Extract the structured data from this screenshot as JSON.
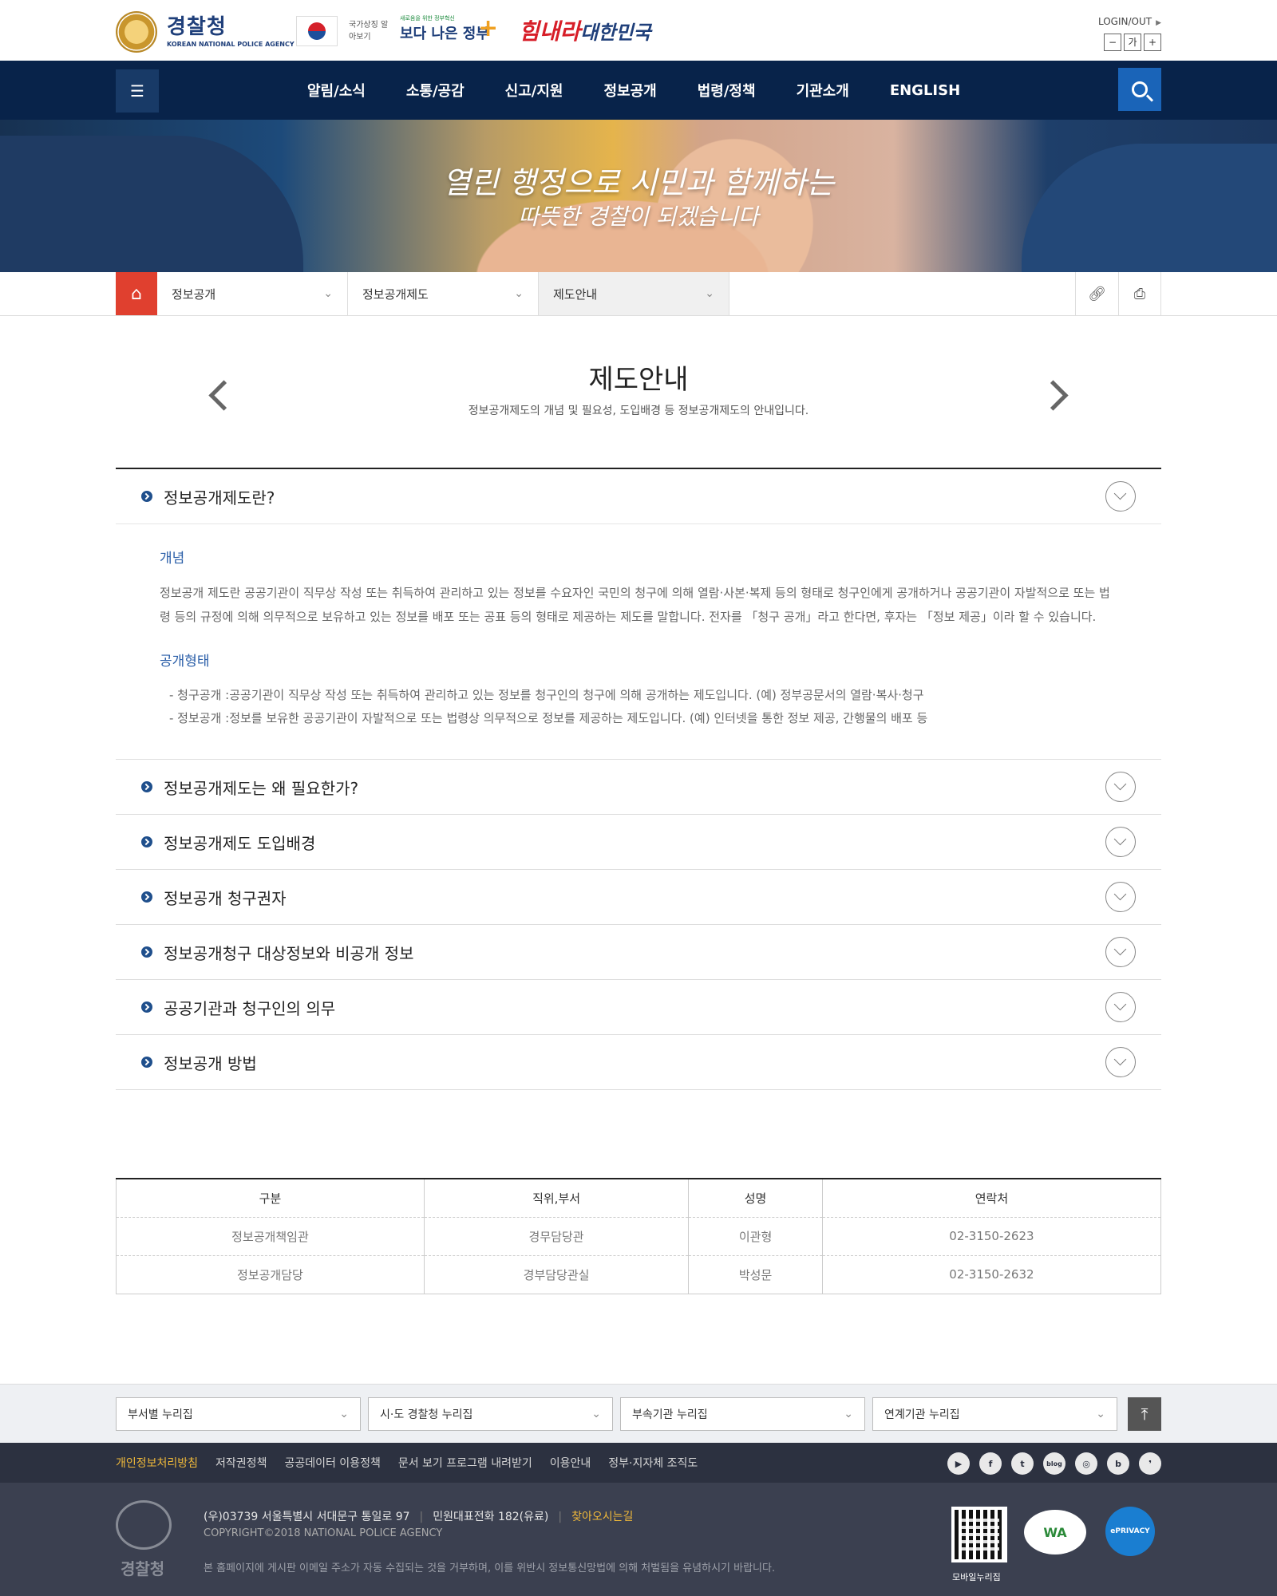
{
  "header": {
    "logo_title": "경찰청",
    "logo_sub": "KOREAN NATIONAL POLICE AGENCY",
    "flag_label": "국가상징 알아보기",
    "banner_gov_small": "새로움을 위한 정부혁신",
    "banner_gov_big": "보다 나은 정부",
    "banner_him_a": "힘내라",
    "banner_him_b": "대한민국",
    "login": "LOGIN/OUT",
    "font_minus": "−",
    "font_size": "가",
    "font_plus": "+"
  },
  "nav": {
    "items": [
      "알림/소식",
      "소통/공감",
      "신고/지원",
      "정보공개",
      "법령/정책",
      "기관소개",
      "ENGLISH"
    ]
  },
  "banner": {
    "line1": "열린 행정으로 시민과 함께하는",
    "line2": "따뜻한 경찰이 되겠습니다"
  },
  "breadcrumb": {
    "items": [
      "정보공개",
      "정보공개제도",
      "제도안내"
    ]
  },
  "page": {
    "title": "제도안내",
    "desc": "정보공개제도의 개념 및 필요성, 도입배경 등 정보공개제도의 안내입니다."
  },
  "accordion": {
    "open": {
      "title": "정보공개제도란?",
      "h1": "개념",
      "p1": "정보공개 제도란 공공기관이 직무상 작성 또는 취득하여 관리하고 있는 정보를 수요자인 국민의 청구에 의해 열람·사본·복제 등의 형태로 청구인에게 공개하거나 공공기관이 자발적으로 또는 법령 등의 규정에 의해 의무적으로 보유하고 있는 정보를 배포 또는 공표 등의 형태로 제공하는 제도를 말합니다. 전자를 「청구 공개」라고 한다면, 후자는 「정보 제공」이라 할 수 있습니다.",
      "h2": "공개형태",
      "li1": "- 청구공개 :공공기관이 직무상 작성 또는 취득하여 관리하고 있는 정보를 청구인의 청구에 의해 공개하는 제도입니다. (예) 정부공문서의 열람·복사·청구",
      "li2": "- 정보공개 :정보를 보유한 공공기관이 자발적으로 또는 법령상 의무적으로 정보를 제공하는 제도입니다. (예) 인터넷을 통한 정보 제공, 간행물의 배포 등"
    },
    "closed": [
      "정보공개제도는 왜 필요한가?",
      "정보공개제도 도입배경",
      "정보공개 청구권자",
      "정보공개청구 대상정보와 비공개 정보",
      "공공기관과 청구인의 의무",
      "정보공개 방법"
    ]
  },
  "contact_table": {
    "headers": [
      "구분",
      "직위,부서",
      "성명",
      "연락처"
    ],
    "rows": [
      [
        "정보공개책임관",
        "경무담당관",
        "이관형",
        "02-3150-2623"
      ],
      [
        "정보공개담당",
        "경부담당관실",
        "박성문",
        "02-3150-2632"
      ]
    ]
  },
  "footer": {
    "selects": [
      "부서별 누리집",
      "시·도 경찰청 누리집",
      "부속기관 누리집",
      "연계기관 누리집"
    ],
    "top_icon": "arrow-up-icon",
    "links": [
      "개인정보처리방침",
      "저작권정책",
      "공공데이터 이용정책",
      "문서 보기 프로그램 내려받기",
      "이용안내",
      "정부·지자체 조직도"
    ],
    "sns": [
      "youtube-icon",
      "facebook-icon",
      "twitter-icon",
      "blog-icon",
      "instagram-icon",
      "band-icon",
      "kakao-icon"
    ],
    "sns_labels": [
      "▶",
      "f",
      "t",
      "blog",
      "◎",
      "b",
      "❜"
    ],
    "emblem_text": "경찰청",
    "address": "(우)03739 서울특별시 서대문구 통일로 97",
    "phone": "민원대표전화 182(유료)",
    "directions": "찾아오시는길",
    "copyright": "COPYRIGHT©2018 NATIONAL POLICE AGENCY",
    "notice": "본 홈페이지에 게시판 이메일 주소가 자동 수집되는 것을 거부하며, 이를 위반시 정보통신망법에 의해 처벌됨을 유념하시기 바랍니다.",
    "qr_label": "모바일누리집",
    "wa_label": "WA",
    "ep_label": "ePRIVACY"
  },
  "colors": {
    "nav_bg": "#08234a",
    "home_red": "#e0402f",
    "accent_blue": "#2a5ea8",
    "footer_bg": "#3b4050",
    "footer_highlight": "#f0b93a"
  }
}
